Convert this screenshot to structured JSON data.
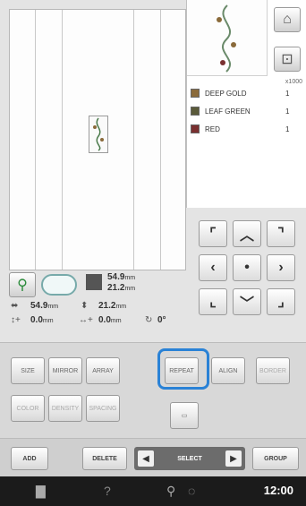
{
  "colors": {
    "accent": "#2a82d6",
    "swatch_1": "#8a6a3a",
    "swatch_2": "#5a5a3a",
    "swatch_3": "#7a3030"
  },
  "pattern_panel": {
    "stitch_label": "x1000",
    "color_list": [
      {
        "name": "DEEP GOLD",
        "num": "1"
      },
      {
        "name": "LEAF GREEN",
        "num": "1"
      },
      {
        "name": "RED",
        "num": "1"
      }
    ]
  },
  "info": {
    "width_top": "54.9",
    "width_top_unit": "mm",
    "height_top": "21.2",
    "height_top_unit": "mm",
    "width_bottom": "54.9",
    "width_bottom_unit": "mm",
    "height_bottom": "21.2",
    "height_bottom_unit": "mm",
    "offset_v": "0.0",
    "offset_v_unit": "mm",
    "offset_h": "0.0",
    "offset_h_unit": "mm",
    "rotation": "0°"
  },
  "tools": {
    "b1": "SIZE",
    "b2": "MIRROR",
    "b3": "ARRAY",
    "b4": "REPEAT",
    "b5": "ALIGN",
    "b6": "BORDER",
    "b7": "COLOR",
    "b8": "DENSITY",
    "b9": "SPACING"
  },
  "bottom_bar": {
    "add": "ADD",
    "delete": "DELETE",
    "select": "SELECT",
    "group": "GROUP"
  },
  "status": {
    "clock": "12:00",
    "help": "?"
  },
  "icons": {
    "home": "home-icon",
    "swap": "swap-icon",
    "help": "lightbulb-icon",
    "hoop": "hoop-icon",
    "size": "size-icon"
  }
}
